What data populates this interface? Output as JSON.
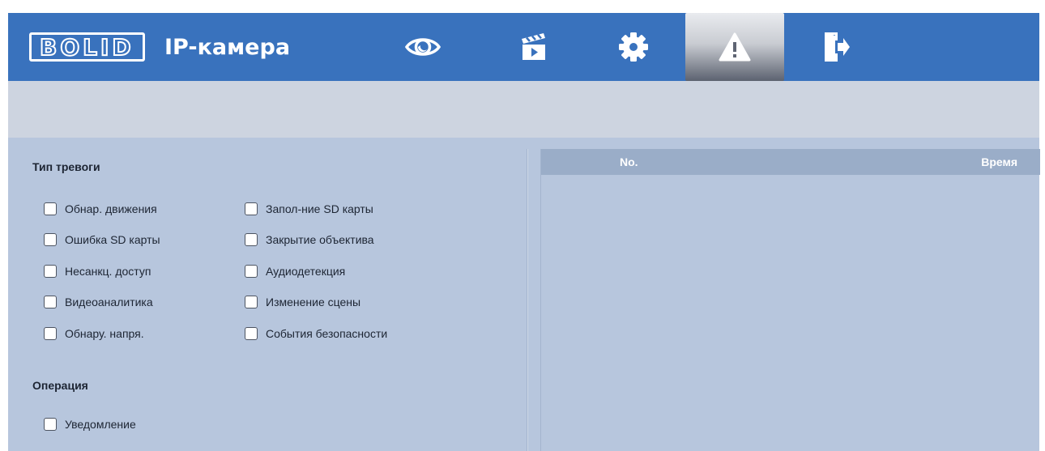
{
  "header": {
    "logo_text": "BOLID",
    "app_title": "IP-камера",
    "nav": [
      {
        "icon": "eye-icon",
        "active": false
      },
      {
        "icon": "clapperboard-icon",
        "active": false
      },
      {
        "icon": "gear-icon",
        "active": false
      },
      {
        "icon": "warning-icon",
        "active": true
      },
      {
        "icon": "logout-icon",
        "active": false
      }
    ]
  },
  "alarm_type": {
    "title": "Тип тревоги",
    "options": [
      {
        "label": "Обнар. движения",
        "checked": false
      },
      {
        "label": "Запол-ние SD карты",
        "checked": false
      },
      {
        "label": "Ошибка SD карты",
        "checked": false
      },
      {
        "label": "Закрытие объектива",
        "checked": false
      },
      {
        "label": "Несанкц. доступ",
        "checked": false
      },
      {
        "label": "Аудиодетекция",
        "checked": false
      },
      {
        "label": "Видеоаналитика",
        "checked": false
      },
      {
        "label": "Изменение сцены",
        "checked": false
      },
      {
        "label": "Обнару. напря.",
        "checked": false
      },
      {
        "label": "События безопасности",
        "checked": false
      }
    ]
  },
  "operation": {
    "title": "Операция",
    "options": [
      {
        "label": "Уведомление",
        "checked": false
      }
    ]
  },
  "event_table": {
    "columns": [
      "No.",
      "Время"
    ],
    "rows": []
  },
  "colors": {
    "header_bg": "#3972bd",
    "content_bg": "#b7c6dd",
    "table_head_bg": "#9aadc8"
  }
}
